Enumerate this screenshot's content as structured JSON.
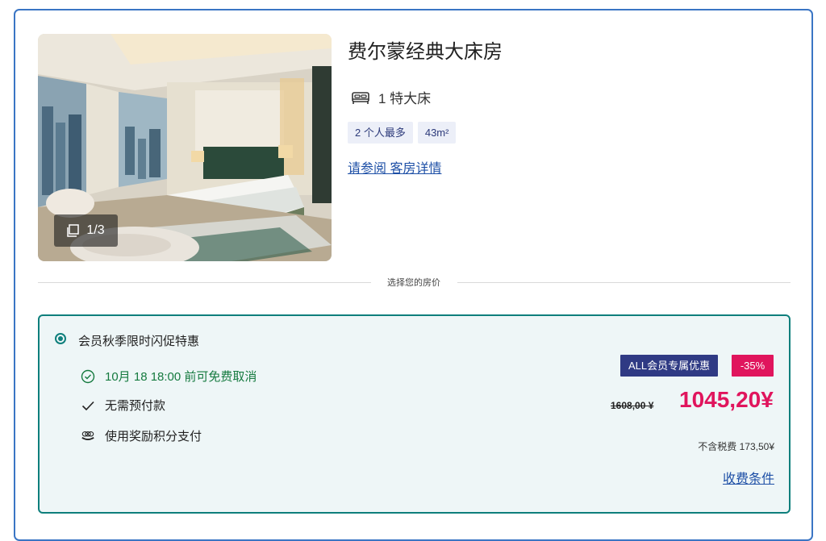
{
  "room": {
    "title": "费尔蒙经典大床房",
    "bed": "1 特大床",
    "tags": [
      "2 个人最多",
      "43m²"
    ],
    "details_link": "请参阅 客房详情",
    "photo_counter": "1/3"
  },
  "divider_label": "选择您的房价",
  "rate": {
    "name": "会员秋季限时闪促特惠",
    "features": [
      {
        "icon": "check-circle-icon",
        "text": "10月 18 18:00 前可免费取消",
        "color": "#157a3f"
      },
      {
        "icon": "checkmark-icon",
        "text": "无需预付款"
      },
      {
        "icon": "points-coin-icon",
        "text": "使用奖励积分支付"
      }
    ],
    "member_badge": "ALL会员专属优惠",
    "discount_badge": "-35%",
    "old_price": "1608,00 ¥",
    "new_price": "1045,20¥",
    "tax": "不含税费 173,50¥",
    "fees_link": "收费条件"
  },
  "colors": {
    "accent_teal": "#0e7f7c",
    "price_red": "#e0155d",
    "member_badge": "#2f3a84",
    "link_blue": "#1d4fa6",
    "card_border": "#3a75c4"
  }
}
